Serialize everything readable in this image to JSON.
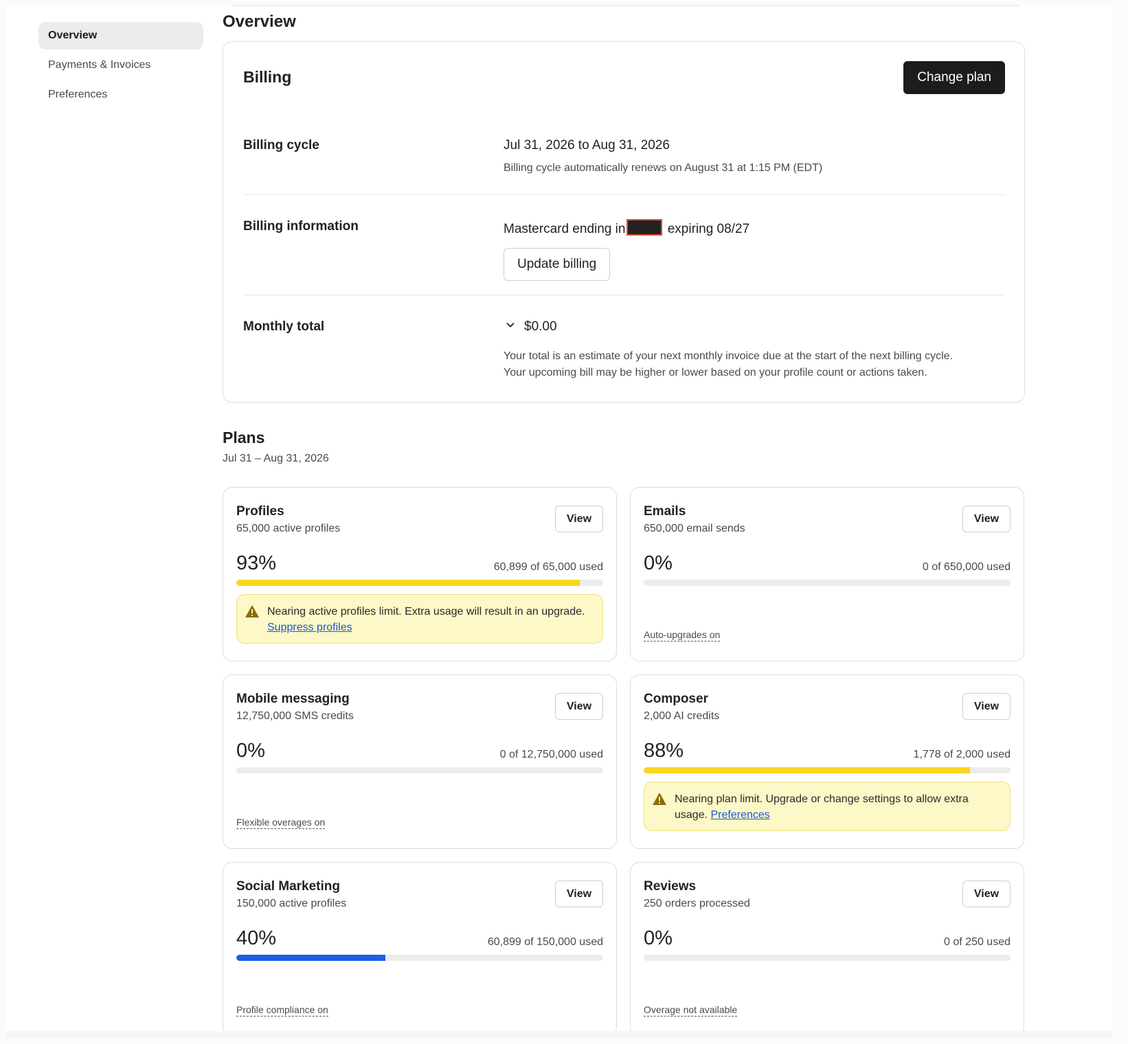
{
  "sidebar": {
    "items": [
      {
        "label": "Overview",
        "active": true
      },
      {
        "label": "Payments & Invoices",
        "active": false
      },
      {
        "label": "Preferences",
        "active": false
      }
    ]
  },
  "page": {
    "title": "Overview"
  },
  "billing": {
    "title": "Billing",
    "change_plan_label": "Change plan",
    "cycle": {
      "label": "Billing cycle",
      "value": "Jul 31, 2026 to Aug 31, 2026",
      "note": "Billing cycle automatically renews on August 31 at 1:15 PM (EDT)"
    },
    "info": {
      "label": "Billing information",
      "card_prefix": "Mastercard ending in",
      "card_suffix": "expiring 08/27",
      "update_label": "Update billing"
    },
    "monthly": {
      "label": "Monthly total",
      "amount": "$0.00",
      "note_line1": "Your total is an estimate of your next monthly invoice due at the start of the next billing cycle.",
      "note_line2": "Your upcoming bill may be higher or lower based on your profile count or actions taken."
    }
  },
  "plans": {
    "title": "Plans",
    "range": "Jul 31 – Aug 31, 2026",
    "view_label": "View",
    "items": [
      {
        "name": "Profiles",
        "sub": "65,000 active profiles",
        "pct": "93%",
        "used": "60,899 of 65,000 used",
        "fill_fraction": 0.937,
        "bar_color": "#f9d61f",
        "warning": "Nearing active profiles limit. Extra usage will result in an upgrade.",
        "warning_link": "Suppress profiles"
      },
      {
        "name": "Emails",
        "sub": "650,000 email sends",
        "pct": "0%",
        "used": "0 of 650,000 used",
        "fill_fraction": 0,
        "bar_color": "#f9d61f",
        "footnote": "Auto-upgrades on"
      },
      {
        "name": "Mobile messaging",
        "sub": "12,750,000 SMS credits",
        "pct": "0%",
        "used": "0 of 12,750,000 used",
        "fill_fraction": 0,
        "bar_color": "#f9d61f",
        "footnote": "Flexible overages on"
      },
      {
        "name": "Composer",
        "sub": "2,000 AI credits",
        "pct": "88%",
        "used": "1,778 of 2,000 used",
        "fill_fraction": 0.889,
        "bar_color": "#f9d61f",
        "warning": "Nearing plan limit. Upgrade or change settings to allow extra usage.",
        "warning_link": "Preferences"
      },
      {
        "name": "Social Marketing",
        "sub": "150,000 active profiles",
        "pct": "40%",
        "used": "60,899 of 150,000 used",
        "fill_fraction": 0.406,
        "bar_color": "#1f5ee6",
        "footnote": "Profile compliance on"
      },
      {
        "name": "Reviews",
        "sub": "250 orders processed",
        "pct": "0%",
        "used": "0 of 250 used",
        "fill_fraction": 0,
        "bar_color": "#f9d61f",
        "footnote": "Overage not available"
      }
    ]
  },
  "colors": {
    "accent_dark": "#1c1c1c",
    "warning_bg": "#fdf8c8",
    "warning_icon": "#8a6d00",
    "link": "#1d56d6",
    "progress_yellow": "#f9d61f",
    "progress_blue": "#1f5ee6"
  },
  "icons": {
    "monthly_toggle": "chevron-down-icon",
    "warning": "warning-triangle-icon"
  }
}
